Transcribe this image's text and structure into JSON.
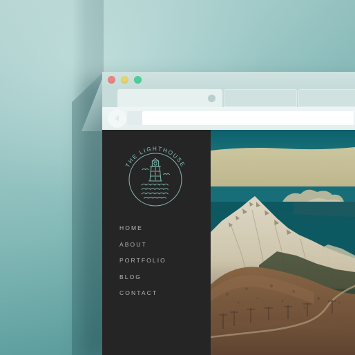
{
  "browser": {
    "traffic_lights": [
      {
        "name": "close",
        "color": "#e8857f"
      },
      {
        "name": "minimize",
        "color": "#e3d56d"
      },
      {
        "name": "maximize",
        "color": "#4ecf9a"
      }
    ],
    "tabs": [
      {
        "label": "",
        "active": true
      },
      {
        "label": "",
        "active": false
      },
      {
        "label": "",
        "active": false
      }
    ],
    "back_button_icon": "back-arrow-icon",
    "address_bar_value": "",
    "address_bar_placeholder": ""
  },
  "site": {
    "logo": {
      "curved_text": "THE LIGHTHOUSE",
      "emblem": "lighthouse-emblem",
      "stroke_color": "#7fb4ad"
    },
    "nav": {
      "items": [
        {
          "label": "HOME"
        },
        {
          "label": "ABOUT"
        },
        {
          "label": "PORTFOLIO"
        },
        {
          "label": "BLOG"
        },
        {
          "label": "CONTACT"
        }
      ]
    },
    "sidebar_color": "#252525",
    "nav_text_color": "#b6b6b6"
  },
  "hero": {
    "image_alt": "snow-capped mountain over golden tussock hills with winding road",
    "sky_color": "#15707a",
    "cloud_color": "#d9cfa2",
    "snow_color": "#e4dcc4",
    "hill_color": "#8d6a4a"
  },
  "backdrop": {
    "gradient_start": "#b2d2d0",
    "gradient_end": "#4e9497"
  }
}
